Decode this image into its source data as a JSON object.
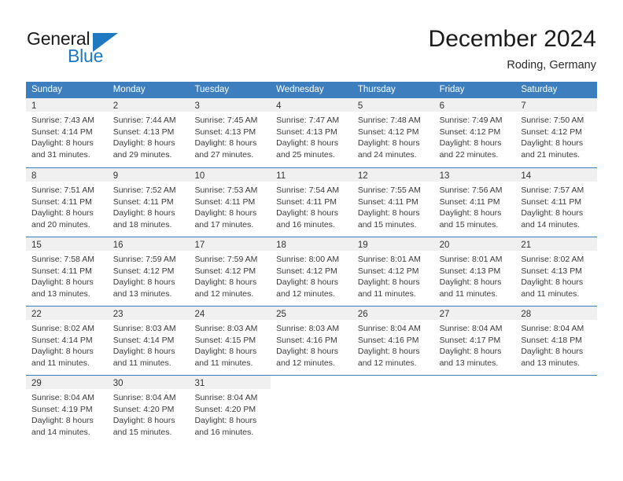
{
  "brand": {
    "name_part1": "General",
    "name_part2": "Blue",
    "triangle_color": "#1f78c1"
  },
  "header": {
    "title": "December 2024",
    "subtitle": "Roding, Germany"
  },
  "theme": {
    "header_blue": "#3d7ebe",
    "day_band_gray": "#f0f0f0",
    "text_color": "#3a3a3a"
  },
  "weekdays": [
    "Sunday",
    "Monday",
    "Tuesday",
    "Wednesday",
    "Thursday",
    "Friday",
    "Saturday"
  ],
  "weeks": [
    [
      {
        "day": "1",
        "sunrise": "Sunrise: 7:43 AM",
        "sunset": "Sunset: 4:14 PM",
        "daylight_line1": "Daylight: 8 hours",
        "daylight_line2": "and 31 minutes."
      },
      {
        "day": "2",
        "sunrise": "Sunrise: 7:44 AM",
        "sunset": "Sunset: 4:13 PM",
        "daylight_line1": "Daylight: 8 hours",
        "daylight_line2": "and 29 minutes."
      },
      {
        "day": "3",
        "sunrise": "Sunrise: 7:45 AM",
        "sunset": "Sunset: 4:13 PM",
        "daylight_line1": "Daylight: 8 hours",
        "daylight_line2": "and 27 minutes."
      },
      {
        "day": "4",
        "sunrise": "Sunrise: 7:47 AM",
        "sunset": "Sunset: 4:13 PM",
        "daylight_line1": "Daylight: 8 hours",
        "daylight_line2": "and 25 minutes."
      },
      {
        "day": "5",
        "sunrise": "Sunrise: 7:48 AM",
        "sunset": "Sunset: 4:12 PM",
        "daylight_line1": "Daylight: 8 hours",
        "daylight_line2": "and 24 minutes."
      },
      {
        "day": "6",
        "sunrise": "Sunrise: 7:49 AM",
        "sunset": "Sunset: 4:12 PM",
        "daylight_line1": "Daylight: 8 hours",
        "daylight_line2": "and 22 minutes."
      },
      {
        "day": "7",
        "sunrise": "Sunrise: 7:50 AM",
        "sunset": "Sunset: 4:12 PM",
        "daylight_line1": "Daylight: 8 hours",
        "daylight_line2": "and 21 minutes."
      }
    ],
    [
      {
        "day": "8",
        "sunrise": "Sunrise: 7:51 AM",
        "sunset": "Sunset: 4:11 PM",
        "daylight_line1": "Daylight: 8 hours",
        "daylight_line2": "and 20 minutes."
      },
      {
        "day": "9",
        "sunrise": "Sunrise: 7:52 AM",
        "sunset": "Sunset: 4:11 PM",
        "daylight_line1": "Daylight: 8 hours",
        "daylight_line2": "and 18 minutes."
      },
      {
        "day": "10",
        "sunrise": "Sunrise: 7:53 AM",
        "sunset": "Sunset: 4:11 PM",
        "daylight_line1": "Daylight: 8 hours",
        "daylight_line2": "and 17 minutes."
      },
      {
        "day": "11",
        "sunrise": "Sunrise: 7:54 AM",
        "sunset": "Sunset: 4:11 PM",
        "daylight_line1": "Daylight: 8 hours",
        "daylight_line2": "and 16 minutes."
      },
      {
        "day": "12",
        "sunrise": "Sunrise: 7:55 AM",
        "sunset": "Sunset: 4:11 PM",
        "daylight_line1": "Daylight: 8 hours",
        "daylight_line2": "and 15 minutes."
      },
      {
        "day": "13",
        "sunrise": "Sunrise: 7:56 AM",
        "sunset": "Sunset: 4:11 PM",
        "daylight_line1": "Daylight: 8 hours",
        "daylight_line2": "and 15 minutes."
      },
      {
        "day": "14",
        "sunrise": "Sunrise: 7:57 AM",
        "sunset": "Sunset: 4:11 PM",
        "daylight_line1": "Daylight: 8 hours",
        "daylight_line2": "and 14 minutes."
      }
    ],
    [
      {
        "day": "15",
        "sunrise": "Sunrise: 7:58 AM",
        "sunset": "Sunset: 4:11 PM",
        "daylight_line1": "Daylight: 8 hours",
        "daylight_line2": "and 13 minutes."
      },
      {
        "day": "16",
        "sunrise": "Sunrise: 7:59 AM",
        "sunset": "Sunset: 4:12 PM",
        "daylight_line1": "Daylight: 8 hours",
        "daylight_line2": "and 13 minutes."
      },
      {
        "day": "17",
        "sunrise": "Sunrise: 7:59 AM",
        "sunset": "Sunset: 4:12 PM",
        "daylight_line1": "Daylight: 8 hours",
        "daylight_line2": "and 12 minutes."
      },
      {
        "day": "18",
        "sunrise": "Sunrise: 8:00 AM",
        "sunset": "Sunset: 4:12 PM",
        "daylight_line1": "Daylight: 8 hours",
        "daylight_line2": "and 12 minutes."
      },
      {
        "day": "19",
        "sunrise": "Sunrise: 8:01 AM",
        "sunset": "Sunset: 4:12 PM",
        "daylight_line1": "Daylight: 8 hours",
        "daylight_line2": "and 11 minutes."
      },
      {
        "day": "20",
        "sunrise": "Sunrise: 8:01 AM",
        "sunset": "Sunset: 4:13 PM",
        "daylight_line1": "Daylight: 8 hours",
        "daylight_line2": "and 11 minutes."
      },
      {
        "day": "21",
        "sunrise": "Sunrise: 8:02 AM",
        "sunset": "Sunset: 4:13 PM",
        "daylight_line1": "Daylight: 8 hours",
        "daylight_line2": "and 11 minutes."
      }
    ],
    [
      {
        "day": "22",
        "sunrise": "Sunrise: 8:02 AM",
        "sunset": "Sunset: 4:14 PM",
        "daylight_line1": "Daylight: 8 hours",
        "daylight_line2": "and 11 minutes."
      },
      {
        "day": "23",
        "sunrise": "Sunrise: 8:03 AM",
        "sunset": "Sunset: 4:14 PM",
        "daylight_line1": "Daylight: 8 hours",
        "daylight_line2": "and 11 minutes."
      },
      {
        "day": "24",
        "sunrise": "Sunrise: 8:03 AM",
        "sunset": "Sunset: 4:15 PM",
        "daylight_line1": "Daylight: 8 hours",
        "daylight_line2": "and 11 minutes."
      },
      {
        "day": "25",
        "sunrise": "Sunrise: 8:03 AM",
        "sunset": "Sunset: 4:16 PM",
        "daylight_line1": "Daylight: 8 hours",
        "daylight_line2": "and 12 minutes."
      },
      {
        "day": "26",
        "sunrise": "Sunrise: 8:04 AM",
        "sunset": "Sunset: 4:16 PM",
        "daylight_line1": "Daylight: 8 hours",
        "daylight_line2": "and 12 minutes."
      },
      {
        "day": "27",
        "sunrise": "Sunrise: 8:04 AM",
        "sunset": "Sunset: 4:17 PM",
        "daylight_line1": "Daylight: 8 hours",
        "daylight_line2": "and 13 minutes."
      },
      {
        "day": "28",
        "sunrise": "Sunrise: 8:04 AM",
        "sunset": "Sunset: 4:18 PM",
        "daylight_line1": "Daylight: 8 hours",
        "daylight_line2": "and 13 minutes."
      }
    ],
    [
      {
        "day": "29",
        "sunrise": "Sunrise: 8:04 AM",
        "sunset": "Sunset: 4:19 PM",
        "daylight_line1": "Daylight: 8 hours",
        "daylight_line2": "and 14 minutes."
      },
      {
        "day": "30",
        "sunrise": "Sunrise: 8:04 AM",
        "sunset": "Sunset: 4:20 PM",
        "daylight_line1": "Daylight: 8 hours",
        "daylight_line2": "and 15 minutes."
      },
      {
        "day": "31",
        "sunrise": "Sunrise: 8:04 AM",
        "sunset": "Sunset: 4:20 PM",
        "daylight_line1": "Daylight: 8 hours",
        "daylight_line2": "and 16 minutes."
      },
      {
        "day": "",
        "sunrise": "",
        "sunset": "",
        "daylight_line1": "",
        "daylight_line2": ""
      },
      {
        "day": "",
        "sunrise": "",
        "sunset": "",
        "daylight_line1": "",
        "daylight_line2": ""
      },
      {
        "day": "",
        "sunrise": "",
        "sunset": "",
        "daylight_line1": "",
        "daylight_line2": ""
      },
      {
        "day": "",
        "sunrise": "",
        "sunset": "",
        "daylight_line1": "",
        "daylight_line2": ""
      }
    ]
  ]
}
